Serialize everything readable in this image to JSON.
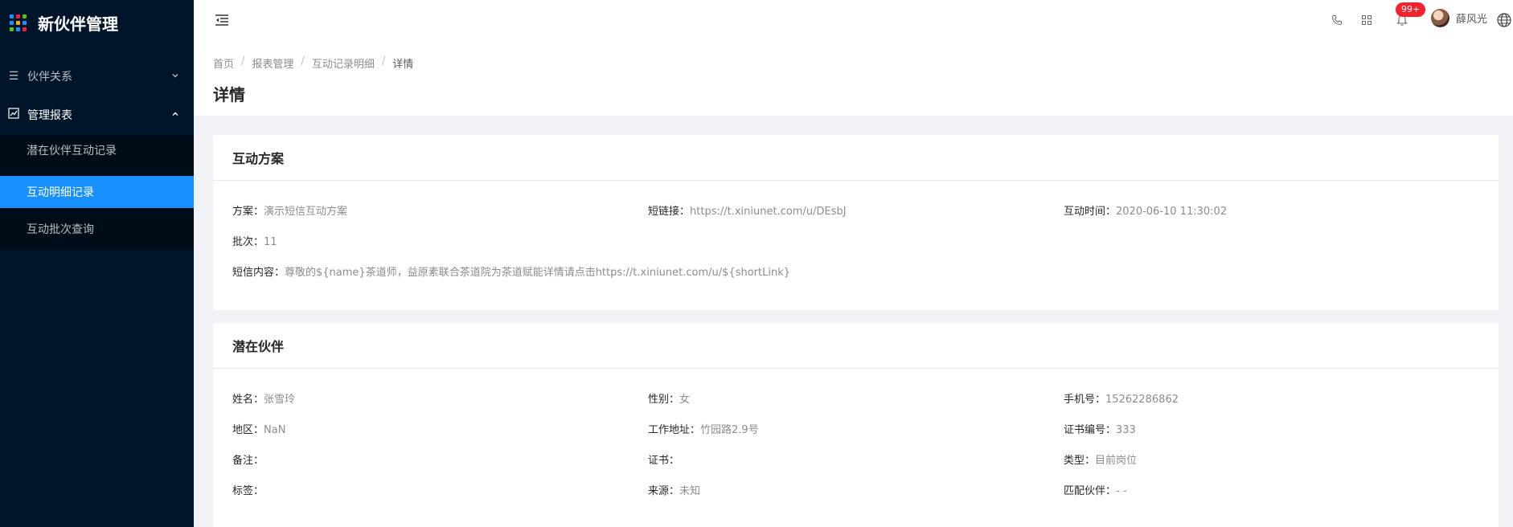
{
  "app": {
    "title": "新伙伴管理",
    "logo_colors": [
      "#1890ff",
      "#f5222d",
      "#52c41a",
      "#1890ff",
      "#faad14",
      "#1890ff",
      "#52c41a",
      "#1890ff",
      "#f5222d"
    ]
  },
  "sidebar": {
    "groups": [
      {
        "label": "伙伴关系",
        "icon": "list-icon",
        "expanded": false
      },
      {
        "label": "管理报表",
        "icon": "chart-icon",
        "expanded": true
      }
    ],
    "sub_items": [
      {
        "label": "潜在伙伴互动记录",
        "active": false
      },
      {
        "label": "互动明细记录",
        "active": true
      },
      {
        "label": "互动批次查询",
        "active": false
      }
    ]
  },
  "header": {
    "notifications": "99+",
    "user": "薛风光"
  },
  "breadcrumb": [
    "首页",
    "报表管理",
    "互动记录明细",
    "详情"
  ],
  "page_title": "详情",
  "card1": {
    "title": "互动方案",
    "fields": [
      {
        "label": "方案：",
        "value": "演示短信互动方案"
      },
      {
        "label": "短链接：",
        "value": "https://t.xiniunet.com/u/DEsbJ"
      },
      {
        "label": "互动时间：",
        "value": "2020-06-10 11:30:02"
      },
      {
        "label": "批次：",
        "value": "11"
      },
      {
        "label": "短信内容：",
        "value": "尊敬的${name}茶道师，益原素联合茶道院为茶道赋能详情请点击https://t.xiniunet.com/u/${shortLink}"
      }
    ]
  },
  "card2": {
    "title": "潜在伙伴",
    "fields": [
      {
        "label": "姓名：",
        "value": "张雪玲"
      },
      {
        "label": "性别：",
        "value": "女"
      },
      {
        "label": "手机号：",
        "value": "15262286862"
      },
      {
        "label": "地区：",
        "value": "NaN"
      },
      {
        "label": "工作地址：",
        "value": "竹园路2.9号"
      },
      {
        "label": "证书编号：",
        "value": "333"
      },
      {
        "label": "备注：",
        "value": ""
      },
      {
        "label": "证书：",
        "value": ""
      },
      {
        "label": "类型：",
        "value": "目前岗位"
      },
      {
        "label": "标签：",
        "value": ""
      },
      {
        "label": "来源：",
        "value": "未知"
      },
      {
        "label": "匹配伙伴：",
        "value": "- -"
      }
    ]
  }
}
